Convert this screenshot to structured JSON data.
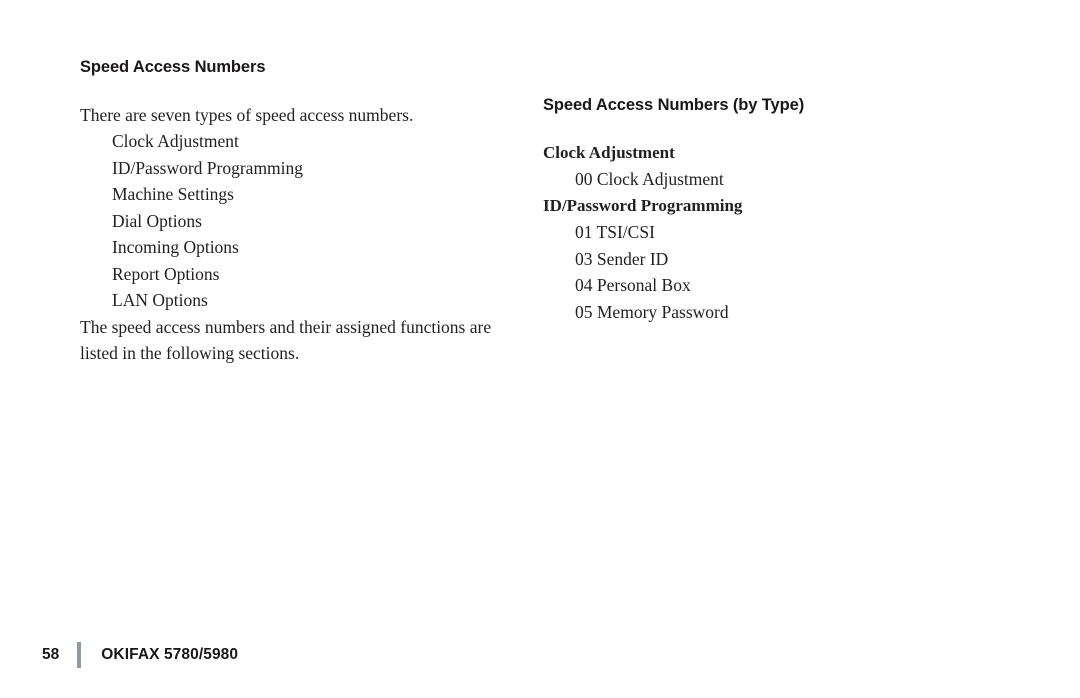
{
  "page": {
    "background_color": "#ffffff",
    "text_color": "#231f20"
  },
  "left_column": {
    "heading": "Speed Access Numbers",
    "intro_paragraph": "There are seven types of speed access numbers.",
    "types": [
      "Clock Adjustment",
      "ID/Password Programming",
      "Machine  Settings",
      "Dial Options",
      "Incoming  Options",
      "Report  Options",
      "LAN Options"
    ],
    "closing_paragraph": "The speed access numbers and their assigned functions are listed in the following sections."
  },
  "right_column": {
    "heading": "Speed Access Numbers (by Type)",
    "groups": [
      {
        "title": "Clock Adjustment",
        "entries": [
          "00 Clock Adjustment"
        ]
      },
      {
        "title": "ID/Password Programming",
        "entries": [
          "01 TSI/CSI",
          "03 Sender ID",
          "04 Personal Box",
          "05 Memory Password"
        ]
      }
    ]
  },
  "footer": {
    "page_number": "58",
    "product_name": "OKIFAX 5780/5980",
    "rule_color": "#8d9b9e"
  }
}
